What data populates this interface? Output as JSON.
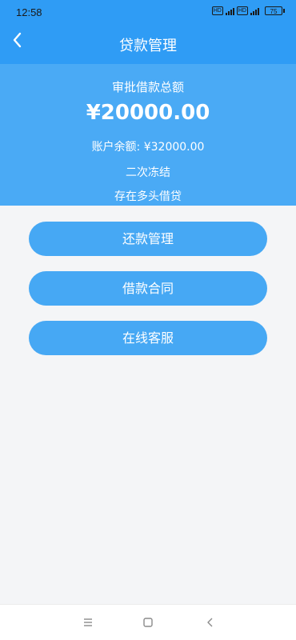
{
  "status_bar": {
    "time": "12:58",
    "network_badge_1": "HD",
    "network_badge_2": "HD",
    "battery": "75"
  },
  "header": {
    "title": "贷款管理",
    "back_icon": "chevron-left-icon"
  },
  "summary": {
    "label": "审批借款总额",
    "amount": "¥20000.00",
    "balance": "账户余额: ¥32000.00",
    "status_1": "二次冻结",
    "status_2": "存在多头借贷"
  },
  "actions": [
    {
      "label": "还款管理"
    },
    {
      "label": "借款合同"
    },
    {
      "label": "在线客服"
    }
  ],
  "system_nav": {
    "menu_icon": "menu-icon",
    "home_icon": "home-square-icon",
    "back_icon": "back-triangle-icon"
  },
  "colors": {
    "primary": "#2f9cf5",
    "summary_bg": "#4aaaf5",
    "button_bg": "#46a8f4",
    "page_bg": "#f4f5f7"
  }
}
